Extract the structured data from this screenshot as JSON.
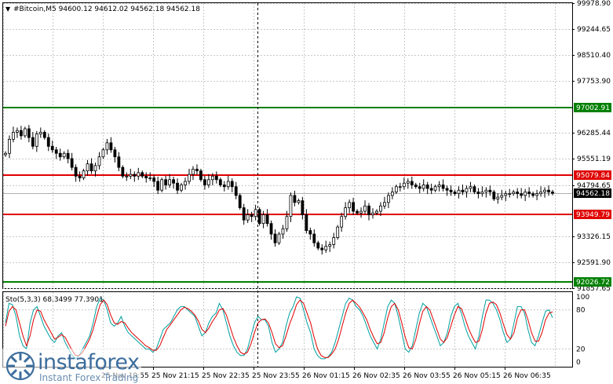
{
  "header": {
    "menu_glyph": "▼",
    "symbol_info": "#Bitcoin,M5  94600.12 94612.02 94562.18 94562.18"
  },
  "indicator": {
    "label": "Sto(5,3,3) 68.3499 77.3901",
    "levels": [
      "100",
      "80",
      "20",
      "0"
    ]
  },
  "price_axis": {
    "ticks": [
      "99978.90",
      "99244.65",
      "98510.40",
      "97753.90",
      "97002.91",
      "96285.44",
      "95551.19",
      "95079.84",
      "94794.65",
      "94562.18",
      "93949.79",
      "93326.15",
      "92591.90",
      "92026.72",
      "91857.65"
    ]
  },
  "time_axis": {
    "ticks": [
      "25 Nov 19:55",
      "25 Nov 21:15",
      "25 Nov 22:35",
      "25 Nov 23:55",
      "26 Nov 01:15",
      "26 Nov 02:35",
      "26 Nov 03:55",
      "26 Nov 05:15",
      "26 Nov 06:35"
    ]
  },
  "levels": {
    "green_top": "97002.91",
    "red_upper": "95079.84",
    "current": "94562.18",
    "red_lower": "93949.79",
    "green_bottom": "92026.72"
  },
  "watermark": {
    "name": "instaforex",
    "tagline": "Instant Forex Trading",
    "logo_icon": "instaforex-logo-icon"
  },
  "colors": {
    "grid": "#c8c8c8",
    "candle": "#000000",
    "support_green": "#008000",
    "resistance_red": "#e00000",
    "current_label": "#000000",
    "stoch_main": "#00a0a0",
    "stoch_signal": "#e00000",
    "watermark": "#3d6e9e"
  },
  "chart_data": {
    "type": "candlestick",
    "symbol": "#Bitcoin",
    "timeframe": "M5",
    "ylim": [
      91857.65,
      99978.9
    ],
    "ohlc_last": {
      "open": 94600.12,
      "high": 94612.02,
      "low": 94562.18,
      "close": 94562.18
    },
    "close_series": [
      95700,
      96100,
      96300,
      96350,
      96200,
      96400,
      96150,
      95900,
      96250,
      96300,
      96150,
      95900,
      95800,
      95700,
      95600,
      95700,
      95550,
      95300,
      95050,
      95000,
      95200,
      95400,
      95200,
      95350,
      95600,
      95800,
      96000,
      95800,
      95600,
      95300,
      95050,
      95050,
      95100,
      95050,
      95150,
      95050,
      95000,
      95000,
      94900,
      94650,
      94950,
      94800,
      94950,
      94850,
      94650,
      94800,
      94900,
      95100,
      95250,
      95200,
      94950,
      94800,
      94950,
      95050,
      94950,
      94800,
      94750,
      94900,
      94750,
      94500,
      94150,
      93800,
      93950,
      93900,
      94100,
      93700,
      93950,
      93700,
      93400,
      93150,
      93400,
      93550,
      93900,
      94500,
      94300,
      94350,
      93950,
      93500,
      93400,
      93150,
      93000,
      92950,
      93050,
      93100,
      93300,
      93600,
      93900,
      94150,
      94300,
      94050,
      94000,
      94050,
      94200,
      93950,
      94000,
      94050,
      94200,
      94300,
      94500,
      94600,
      94750,
      94750,
      94850,
      94900,
      94800,
      94750,
      94700,
      94800,
      94700,
      94650,
      94750,
      94800,
      94700,
      94650,
      94600,
      94550,
      94650,
      94600,
      94700,
      94750,
      94600,
      94550,
      94600,
      94650,
      94600,
      94400,
      94450,
      94500,
      94550,
      94550,
      94600,
      94550,
      94500,
      94600,
      94550,
      94500,
      94550,
      94600,
      94650,
      94600,
      94562
    ],
    "horizontal_levels": [
      {
        "value": 97002.91,
        "color": "green"
      },
      {
        "value": 95079.84,
        "color": "red"
      },
      {
        "value": 93949.79,
        "color": "red"
      },
      {
        "value": 92026.72,
        "color": "green"
      }
    ],
    "stochastic": {
      "params": "5,3,3",
      "main_last": 68.3499,
      "signal_last": 77.3901,
      "ylim": [
        0,
        100
      ],
      "main": [
        60,
        90,
        88,
        70,
        40,
        25,
        20,
        60,
        80,
        85,
        70,
        55,
        45,
        35,
        30,
        40,
        45,
        30,
        20,
        10,
        5,
        10,
        20,
        30,
        40,
        60,
        85,
        98,
        95,
        80,
        60,
        55,
        60,
        70,
        55,
        45,
        40,
        35,
        30,
        25,
        20,
        20,
        15,
        20,
        35,
        50,
        55,
        60,
        70,
        80,
        85,
        85,
        80,
        75,
        70,
        55,
        40,
        45,
        60,
        70,
        75,
        90,
        80,
        60,
        40,
        25,
        15,
        10,
        10,
        20,
        40,
        60,
        70,
        65,
        65,
        55,
        30,
        15,
        20,
        30,
        55,
        75,
        85,
        100,
        98,
        80,
        60,
        45,
        20,
        10,
        5,
        5,
        8,
        15,
        30,
        50,
        70,
        90,
        98,
        95,
        85,
        80,
        70,
        55,
        40,
        30,
        20,
        35,
        60,
        85,
        95,
        90,
        70,
        45,
        20,
        15,
        25,
        50,
        75,
        90,
        85,
        70,
        55,
        40,
        25,
        30,
        45,
        70,
        85,
        90,
        75,
        55,
        40,
        30,
        20,
        40,
        70,
        95,
        95,
        90,
        80,
        65,
        45,
        30,
        35,
        60,
        85,
        85,
        75,
        50,
        30,
        25,
        40,
        60,
        78,
        80,
        68
      ],
      "signal": [
        55,
        78,
        85,
        80,
        60,
        40,
        25,
        40,
        65,
        80,
        78,
        65,
        55,
        45,
        35,
        38,
        42,
        38,
        28,
        18,
        10,
        10,
        15,
        25,
        35,
        50,
        70,
        88,
        95,
        88,
        72,
        60,
        58,
        62,
        60,
        52,
        45,
        40,
        35,
        30,
        25,
        22,
        18,
        18,
        25,
        38,
        50,
        57,
        65,
        72,
        80,
        84,
        82,
        78,
        72,
        63,
        50,
        45,
        52,
        62,
        70,
        80,
        82,
        72,
        55,
        38,
        25,
        15,
        12,
        15,
        28,
        45,
        60,
        65,
        66,
        60,
        45,
        28,
        22,
        25,
        40,
        58,
        72,
        88,
        95,
        90,
        75,
        60,
        38,
        20,
        10,
        7,
        7,
        12,
        20,
        35,
        55,
        75,
        90,
        95,
        90,
        84,
        75,
        65,
        50,
        38,
        28,
        30,
        45,
        68,
        85,
        90,
        80,
        60,
        38,
        22,
        20,
        35,
        58,
        78,
        85,
        80,
        65,
        50,
        35,
        30,
        38,
        55,
        72,
        85,
        82,
        68,
        52,
        40,
        30,
        32,
        50,
        75,
        90,
        92,
        88,
        75,
        58,
        42,
        35,
        45,
        68,
        80,
        80,
        65,
        45,
        32,
        32,
        45,
        65,
        75,
        77
      ]
    }
  }
}
